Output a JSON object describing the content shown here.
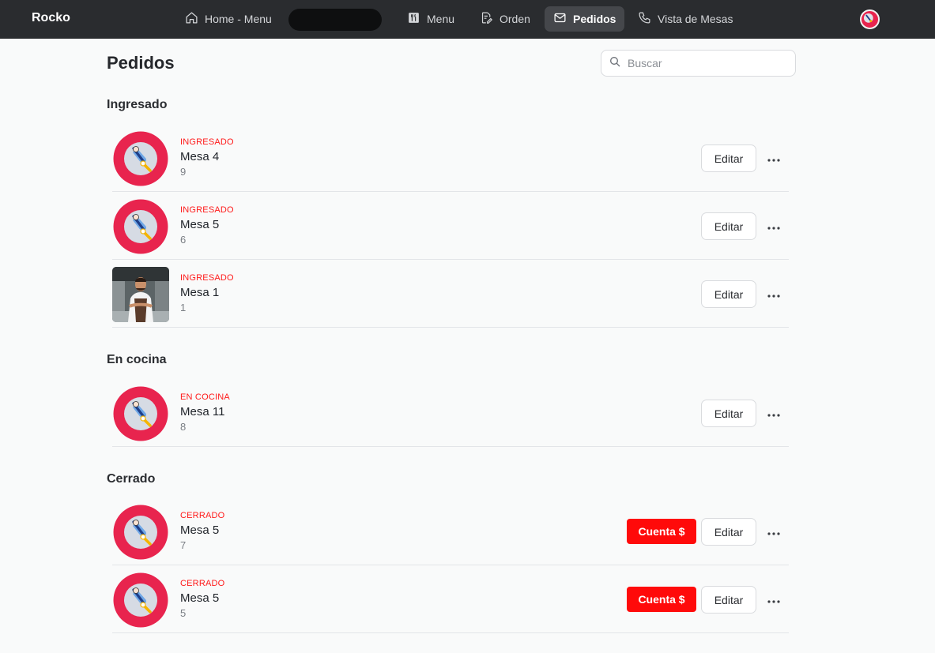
{
  "brand": "Rocko",
  "nav": {
    "home": "Home - Menu",
    "menu": "Menu",
    "orden": "Orden",
    "pedidos": "Pedidos",
    "mesas": "Vista de Mesas"
  },
  "header": {
    "title": "Pedidos",
    "search_placeholder": "Buscar"
  },
  "colors": {
    "status_red": "#ff1a1a",
    "cuenta_button": "#ff0a0a",
    "avatar_pink": "#e8244e",
    "topbar": "#2a2c2f"
  },
  "sections": [
    {
      "title": "Ingresado",
      "orders": [
        {
          "status": "INGRESADO",
          "name": "Mesa 4",
          "number": "9",
          "avatar": "chef-logo",
          "edit_label": "Editar"
        },
        {
          "status": "INGRESADO",
          "name": "Mesa 5",
          "number": "6",
          "avatar": "chef-logo",
          "edit_label": "Editar"
        },
        {
          "status": "INGRESADO",
          "name": "Mesa 1",
          "number": "1",
          "avatar": "waiter-photo",
          "edit_label": "Editar"
        }
      ]
    },
    {
      "title": "En cocina",
      "orders": [
        {
          "status": "EN COCINA",
          "name": "Mesa 11",
          "number": "8",
          "avatar": "chef-logo",
          "edit_label": "Editar"
        }
      ]
    },
    {
      "title": "Cerrado",
      "orders": [
        {
          "status": "CERRADO",
          "name": "Mesa 5",
          "number": "7",
          "avatar": "chef-logo",
          "cuenta_label": "Cuenta $",
          "edit_label": "Editar"
        },
        {
          "status": "CERRADO",
          "name": "Mesa 5",
          "number": "5",
          "avatar": "chef-logo",
          "cuenta_label": "Cuenta $",
          "edit_label": "Editar"
        }
      ]
    }
  ]
}
